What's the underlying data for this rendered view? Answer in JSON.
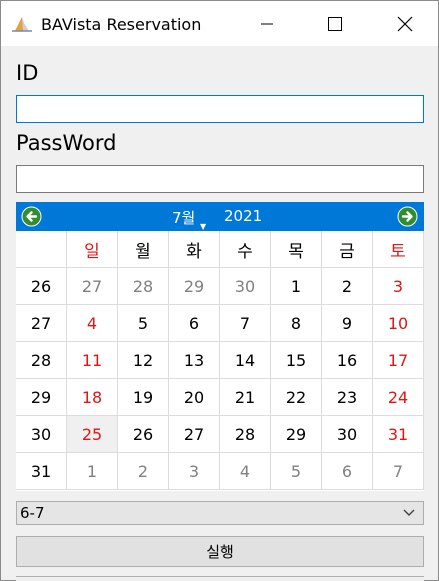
{
  "window": {
    "title": "BAVista Reservation",
    "accent": "#0078d7"
  },
  "form": {
    "id_label": "ID",
    "id_value": "",
    "password_label": "PassWord",
    "password_value": ""
  },
  "calendar": {
    "month": "7월",
    "year": "2021",
    "weekday_headers": [
      "일",
      "월",
      "화",
      "수",
      "목",
      "금",
      "토"
    ],
    "week_numbers": [
      "26",
      "27",
      "28",
      "29",
      "30",
      "31"
    ],
    "days": [
      [
        "27",
        "28",
        "29",
        "30",
        "1",
        "2",
        "3"
      ],
      [
        "4",
        "5",
        "6",
        "7",
        "8",
        "9",
        "10"
      ],
      [
        "11",
        "12",
        "13",
        "14",
        "15",
        "16",
        "17"
      ],
      [
        "18",
        "19",
        "20",
        "21",
        "22",
        "23",
        "24"
      ],
      [
        "25",
        "26",
        "27",
        "28",
        "29",
        "30",
        "31"
      ],
      [
        "1",
        "2",
        "3",
        "4",
        "5",
        "6",
        "7"
      ]
    ],
    "today": "25",
    "weekend_color": "#e51414",
    "other_month_color": "#808080"
  },
  "time_select": {
    "selected": "6-7"
  },
  "run_button": {
    "label": "실행"
  },
  "icons": {
    "app": "app-logo-icon",
    "minimize": "minimize-icon",
    "maximize": "maximize-icon",
    "close": "close-icon",
    "prev": "prev-month-icon",
    "next": "next-month-icon",
    "dropdown": "chevron-down-icon"
  }
}
